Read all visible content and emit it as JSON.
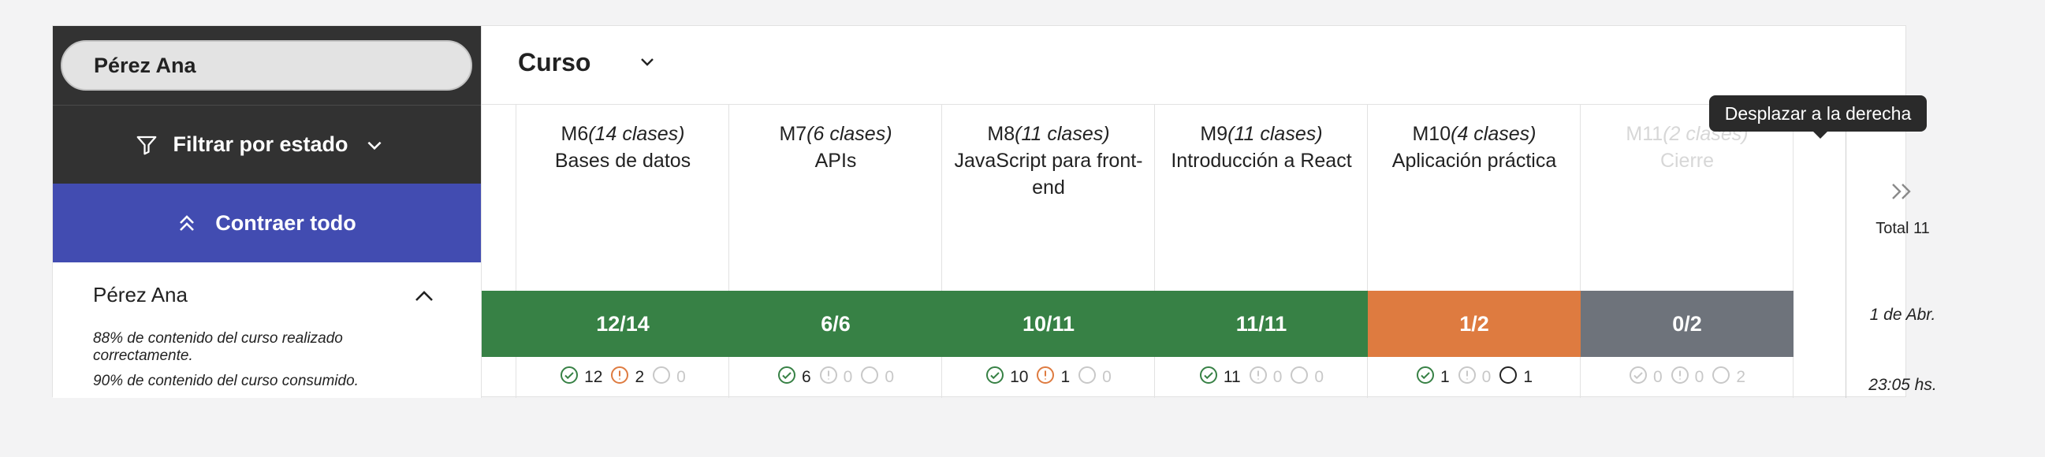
{
  "search": {
    "value": "Pérez Ana"
  },
  "filter": {
    "label": "Filtrar por estado"
  },
  "collapse": {
    "label": "Contraer todo"
  },
  "student": {
    "name": "Pérez Ana",
    "note1": "88% de contenido del curso realizado correctamente.",
    "note2": "90% de contenido del curso consumido."
  },
  "course": {
    "title": "Curso"
  },
  "colors": {
    "green": "#378145",
    "orange": "#de7b40",
    "gray": "#6e737b",
    "accent": "#424cb1"
  },
  "modules": [
    {
      "code": "M6",
      "classes": "(14 clases)",
      "name": "Bases de datos",
      "progress": "12/14",
      "status": "green",
      "done": "12",
      "warn": "2",
      "pending": "0",
      "faded": false
    },
    {
      "code": "M7",
      "classes": "(6 clases)",
      "name": "APIs",
      "progress": "6/6",
      "status": "green",
      "done": "6",
      "warn": "0",
      "pending": "0",
      "faded": false
    },
    {
      "code": "M8",
      "classes": "(11 clases)",
      "name": "JavaScript para front-end",
      "progress": "10/11",
      "status": "green",
      "done": "10",
      "warn": "1",
      "pending": "0",
      "faded": false
    },
    {
      "code": "M9",
      "classes": "(11 clases)",
      "name": "Introducción a React",
      "progress": "11/11",
      "status": "green",
      "done": "11",
      "warn": "0",
      "pending": "0",
      "faded": false
    },
    {
      "code": "M10",
      "classes": "(4 clases)",
      "name": "Aplicación práctica",
      "progress": "1/2",
      "status": "orange",
      "done": "1",
      "warn": "0",
      "pending": "1",
      "faded": false
    },
    {
      "code": "M11",
      "classes": "(2 clases)",
      "name": "Cierre",
      "progress": "0/2",
      "status": "gray",
      "done": "0",
      "warn": "0",
      "pending": "2",
      "faded": true
    }
  ],
  "total": {
    "label": "Total 11",
    "date": "1 de Abr.",
    "time": "23:05 hs."
  },
  "tooltip": {
    "text": "Desplazar a la derecha"
  }
}
